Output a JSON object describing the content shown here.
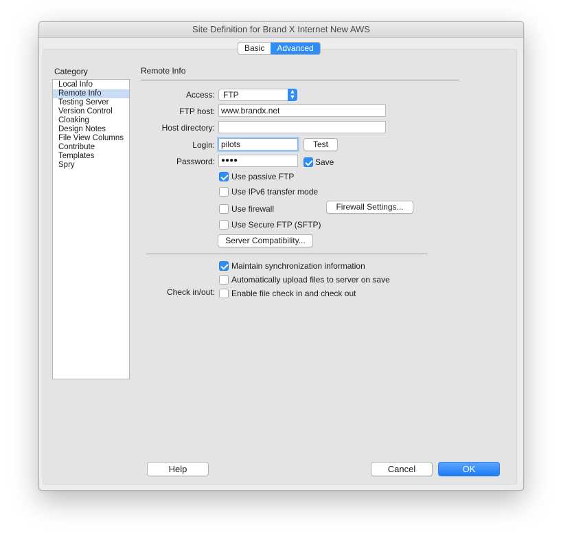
{
  "window": {
    "title": "Site Definition for Brand X Internet New  AWS"
  },
  "tabs": [
    {
      "label": "Basic",
      "active": false
    },
    {
      "label": "Advanced",
      "active": true
    }
  ],
  "category": {
    "heading": "Category",
    "items": [
      {
        "label": "Local Info",
        "selected": false
      },
      {
        "label": "Remote Info",
        "selected": true
      },
      {
        "label": "Testing Server",
        "selected": false
      },
      {
        "label": "Version Control",
        "selected": false
      },
      {
        "label": "Cloaking",
        "selected": false
      },
      {
        "label": "Design Notes",
        "selected": false
      },
      {
        "label": "File View Columns",
        "selected": false
      },
      {
        "label": "Contribute",
        "selected": false
      },
      {
        "label": "Templates",
        "selected": false
      },
      {
        "label": "Spry",
        "selected": false
      }
    ]
  },
  "remote": {
    "section_title": "Remote Info",
    "access_label": "Access:",
    "access_value": "FTP",
    "ftp_host_label": "FTP host:",
    "ftp_host_value": "www.brandx.net",
    "host_dir_label": "Host directory:",
    "host_dir_value": "",
    "login_label": "Login:",
    "login_value": "pilots",
    "test_button": "Test",
    "password_label": "Password:",
    "password_value": "●●●●",
    "save_label": "Save",
    "save_checked": true,
    "passive_ftp_label": "Use passive FTP",
    "passive_ftp_checked": true,
    "ipv6_label": "Use IPv6 transfer mode",
    "ipv6_checked": false,
    "firewall_label": "Use firewall",
    "firewall_checked": false,
    "firewall_settings_button": "Firewall Settings...",
    "sftp_label": "Use Secure FTP (SFTP)",
    "sftp_checked": false,
    "server_compat_button": "Server Compatibility...",
    "sync_label": "Maintain synchronization information",
    "sync_checked": true,
    "auto_upload_label": "Automatically upload files to server on save",
    "auto_upload_checked": false,
    "checkinout_label": "Check in/out:",
    "checkinout_option_label": "Enable file check in and check out",
    "checkinout_checked": false
  },
  "footer": {
    "help_button": "Help",
    "cancel_button": "Cancel",
    "ok_button": "OK"
  },
  "colors": {
    "accent": "#2f8df5",
    "selection": "#c9dcf5",
    "window_bg": "#ececec"
  }
}
